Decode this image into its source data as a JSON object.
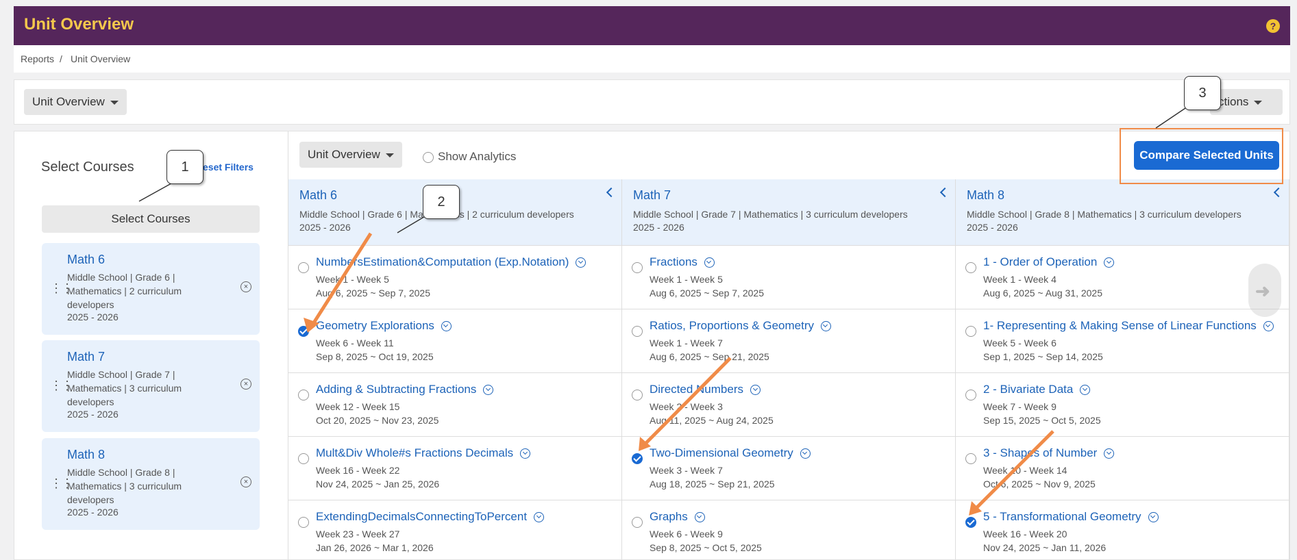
{
  "header": {
    "title": "Unit Overview",
    "help_icon": "help-icon"
  },
  "breadcrumb": {
    "items": [
      "Reports",
      "/",
      "Unit Overview"
    ]
  },
  "toolbar": {
    "view_dropdown": "Unit Overview",
    "actions_label": "ctions"
  },
  "sidebar": {
    "title": "Select Courses",
    "reset_label": "eset Filters",
    "select_button": "Select Courses",
    "courses": [
      {
        "name": "Math 6",
        "desc": "Middle School | Grade 6 | Mathematics | 2 curriculum developers",
        "year": "2025 - 2026"
      },
      {
        "name": "Math 7",
        "desc": "Middle School | Grade 7 | Mathematics | 3 curriculum developers",
        "year": "2025 - 2026"
      },
      {
        "name": "Math 8",
        "desc": "Middle School | Grade 8 | Mathematics | 3 curriculum developers",
        "year": "2025 - 2026"
      }
    ]
  },
  "content": {
    "view_dropdown": "Unit Overview",
    "show_analytics": "Show Analytics",
    "compare_button": "Compare Selected Units",
    "columns": [
      {
        "name": "Math 6",
        "desc": "Middle School | Grade 6 | Mathematics | 2 curriculum developers",
        "year": "2025 - 2026",
        "units": [
          {
            "name": "NumbersEstimation&Computation (Exp.Notation)",
            "weeks": "Week 1 - Week 5",
            "dates": "Aug 6, 2025 ~ Sep 7, 2025",
            "checked": false
          },
          {
            "name": "Geometry Explorations",
            "weeks": "Week 6 - Week 11",
            "dates": "Sep 8, 2025 ~ Oct 19, 2025",
            "checked": true
          },
          {
            "name": "Adding & Subtracting Fractions",
            "weeks": "Week 12 - Week 15",
            "dates": "Oct 20, 2025 ~ Nov 23, 2025",
            "checked": false
          },
          {
            "name": "Mult&Div Whole#s Fractions Decimals",
            "weeks": "Week 16 - Week 22",
            "dates": "Nov 24, 2025 ~ Jan 25, 2026",
            "checked": false
          },
          {
            "name": "ExtendingDecimalsConnectingToPercent",
            "weeks": "Week 23 - Week 27",
            "dates": "Jan 26, 2026 ~ Mar 1, 2026",
            "checked": false
          }
        ]
      },
      {
        "name": "Math 7",
        "desc": "Middle School | Grade 7 | Mathematics | 3 curriculum developers",
        "year": "2025 - 2026",
        "units": [
          {
            "name": "Fractions",
            "weeks": "Week 1 - Week 5",
            "dates": "Aug 6, 2025 ~ Sep 7, 2025",
            "checked": false
          },
          {
            "name": "Ratios, Proportions & Geometry",
            "weeks": "Week 1 - Week 7",
            "dates": "Aug 6, 2025 ~ Sep 21, 2025",
            "checked": false
          },
          {
            "name": "Directed Numbers",
            "weeks": "Week 2 - Week 3",
            "dates": "Aug 11, 2025 ~ Aug 24, 2025",
            "checked": false
          },
          {
            "name": "Two-Dimensional Geometry",
            "weeks": "Week 3 - Week 7",
            "dates": "Aug 18, 2025 ~ Sep 21, 2025",
            "checked": true
          },
          {
            "name": "Graphs",
            "weeks": "Week 6 - Week 9",
            "dates": "Sep 8, 2025 ~ Oct 5, 2025",
            "checked": false
          }
        ]
      },
      {
        "name": "Math 8",
        "desc": "Middle School | Grade 8 | Mathematics | 3 curriculum developers",
        "year": "2025 - 2026",
        "units": [
          {
            "name": "1 - Order of Operation",
            "weeks": "Week 1 - Week 4",
            "dates": "Aug 6, 2025 ~ Aug 31, 2025",
            "checked": false
          },
          {
            "name": "1- Representing & Making Sense of Linear Functions",
            "weeks": "Week 5 - Week 6",
            "dates": "Sep 1, 2025 ~ Sep 14, 2025",
            "checked": false
          },
          {
            "name": "2 - Bivariate Data",
            "weeks": "Week 7 - Week 9",
            "dates": "Sep 15, 2025 ~ Oct 5, 2025",
            "checked": false
          },
          {
            "name": "3 - Shapes of Number",
            "weeks": "Week 10 - Week 14",
            "dates": "Oct 6, 2025 ~ Nov 9, 2025",
            "checked": false
          },
          {
            "name": "5 - Transformational Geometry",
            "weeks": "Week 16 - Week 20",
            "dates": "Nov 24, 2025 ~ Jan 11, 2026",
            "checked": true
          }
        ]
      }
    ]
  },
  "callouts": [
    "1",
    "2",
    "3"
  ],
  "colors": {
    "header_bg": "#55265b",
    "header_title": "#f5c84c",
    "link": "#1d63b8",
    "primary": "#1a6ad3",
    "annotation": "#f08b48"
  }
}
